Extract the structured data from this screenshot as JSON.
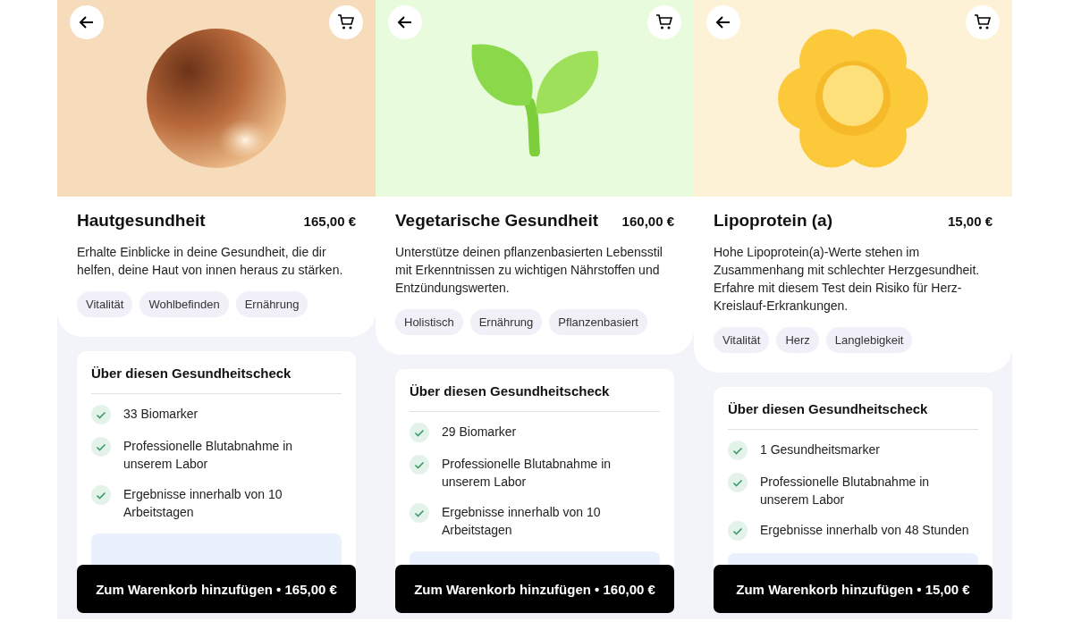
{
  "products": [
    {
      "kind": "sphere",
      "title": "Hautgesundheit",
      "price": "165,00 €",
      "description": "Erhalte Einblicke in deine Gesundheit, die dir helfen, deine Haut von innen heraus zu stärken.",
      "tags": [
        "Vitalität",
        "Wohlbefinden",
        "Ernährung"
      ],
      "about_title": "Über diesen Gesundheitscheck",
      "features": [
        "33 Biomarker",
        "Professionelle Blutabnahme in unserem Labor",
        "Ergebnisse innerhalb von 10 Arbeitstagen"
      ],
      "cta": "Zum Warenkorb hinzufügen • 165,00 €"
    },
    {
      "kind": "sprout",
      "title": "Vegetarische Gesundheit",
      "price": "160,00 €",
      "description": "Unterstütze deinen pflanzenbasierten Lebensstil mit Erkenntnissen zu wichtigen Nährstoffen und Entzündungswerten.",
      "tags": [
        "Holistisch",
        "Ernährung",
        "Pflanzenbasiert"
      ],
      "about_title": "Über diesen Gesundheitscheck",
      "features": [
        "29 Biomarker",
        "Professionelle Blutabnahme in unserem Labor",
        "Ergebnisse innerhalb von 10 Arbeitstagen"
      ],
      "cta": "Zum Warenkorb hinzufügen • 160,00 €"
    },
    {
      "kind": "flower",
      "title": "Lipoprotein (a)",
      "price": "15,00 €",
      "description": "Hohe Lipoprotein(a)-Werte stehen im Zusammenhang mit schlechter Herzgesundheit. Erfahre mit diesem Test dein Risiko für Herz-Kreislauf-Erkrankungen.",
      "tags": [
        "Vitalität",
        "Herz",
        "Langlebigkeit"
      ],
      "about_title": "Über diesen Gesundheitscheck",
      "features": [
        "1 Gesundheitsmarker",
        "Professionelle Blutabnahme in unserem Labor",
        "Ergebnisse innerhalb von 48 Stunden"
      ],
      "cta": "Zum Warenkorb hinzufügen • 15,00 €"
    }
  ]
}
